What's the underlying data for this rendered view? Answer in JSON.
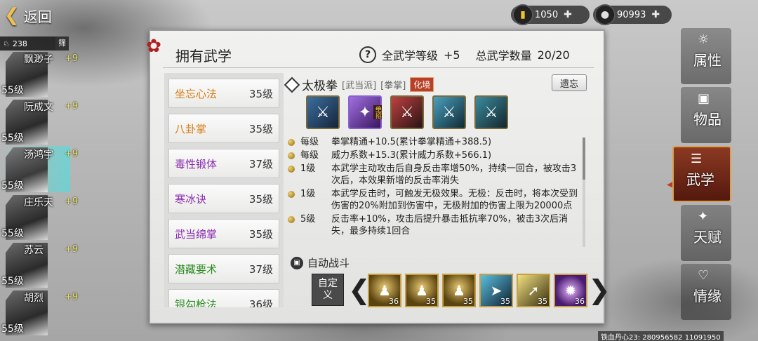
{
  "topbar": {
    "back_label": "返回",
    "gold": "1050",
    "silver": "90993"
  },
  "characters": {
    "count": "238",
    "sort_label": "筛",
    "list": [
      {
        "name": "飘渺子",
        "bonus": "+9",
        "level": "55级"
      },
      {
        "name": "阮成文",
        "bonus": "+9",
        "level": "55级"
      },
      {
        "name": "汤鸿宇",
        "bonus": "+9",
        "level": "55级"
      },
      {
        "name": "庄乐天",
        "bonus": "+9",
        "level": "55级"
      },
      {
        "name": "苏云",
        "bonus": "+9",
        "level": "55级"
      },
      {
        "name": "胡烈",
        "bonus": "+9",
        "level": "55级"
      }
    ]
  },
  "panel": {
    "title": "拥有武学",
    "all_level_label": "全武学等级",
    "all_level_value": "+5",
    "total_label": "总武学数量",
    "total_value": "20/20"
  },
  "skills": [
    {
      "name": "坐忘心法",
      "level": "35级",
      "color": "#d67a10"
    },
    {
      "name": "八卦掌",
      "level": "35级",
      "color": "#d67a10"
    },
    {
      "name": "毒性锻体",
      "level": "37级",
      "color": "#8a2bb0"
    },
    {
      "name": "寒冰诀",
      "level": "35级",
      "color": "#8a2bb0"
    },
    {
      "name": "武当绵掌",
      "level": "35级",
      "color": "#8a2bb0"
    },
    {
      "name": "潜藏要术",
      "level": "37级",
      "color": "#2a8a20"
    },
    {
      "name": "银勾枪法",
      "level": "36级",
      "color": "#2a8a20"
    }
  ],
  "detail": {
    "name": "太极拳",
    "sect_tag": "[武当派]",
    "type_tag": "[拳掌]",
    "badge": "化境",
    "forget_label": "遗忘",
    "move_ultimate_tag": "绝招",
    "effects": [
      {
        "level": "每级",
        "text": "拳掌精通+10.5(累计拳掌精通+388.5)"
      },
      {
        "level": "每级",
        "text": "威力系数+15.3(累计威力系数+566.1)"
      },
      {
        "level": "1级",
        "text": "本武学主动攻击后自身反击率增50%，持续一回合，被攻击3次后，本效果新增的反击率消失"
      },
      {
        "level": "1级",
        "text": "本武学反击时，可触发无极效果。无极：反击时，将本次受到伤害的20%附加到伤害中，无极附加的伤害上限为20000点"
      },
      {
        "level": "5级",
        "text": "反击率+10%，攻击后提升暴击抵抗率70%，被击3次后消失，最多持续1回合"
      }
    ],
    "auto_battle_label": "自动战斗",
    "custom_label": "自定义",
    "slots": [
      {
        "num": "36",
        "kind": "lock"
      },
      {
        "num": "35",
        "kind": "lock"
      },
      {
        "num": "35",
        "kind": "lock"
      },
      {
        "num": "35",
        "kind": "blue"
      },
      {
        "num": "35",
        "kind": "gold"
      },
      {
        "num": "36",
        "kind": "purple"
      }
    ]
  },
  "nav": {
    "tabs": [
      {
        "label": "属性"
      },
      {
        "label": "物品"
      },
      {
        "label": "武学"
      },
      {
        "label": "天赋"
      },
      {
        "label": "情缘"
      }
    ]
  },
  "footer": {
    "info": "铁血丹心23: 280956582 11091950"
  }
}
